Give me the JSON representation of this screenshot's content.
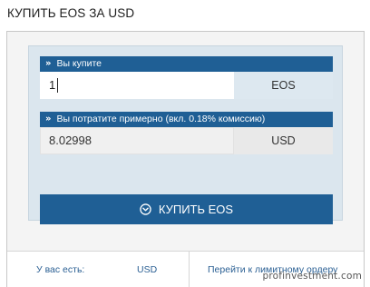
{
  "title": "КУПИТЬ EOS ЗА USD",
  "buy_field": {
    "header": "Вы купите",
    "value": "1",
    "unit": "EOS"
  },
  "spend_field": {
    "header": "Вы потратите примерно (вкл. 0.18% комиссию)",
    "value": "8.02998",
    "unit": "USD"
  },
  "buy_button": {
    "label": "КУПИТЬ EOS",
    "icon": "chevron-down-circle-icon"
  },
  "footer": {
    "balance_label": "У вас есть:",
    "balance_currency": "USD",
    "limit_link": "Перейти к лимитному ордеру"
  },
  "watermark": "profinvestment.com",
  "colors": {
    "primary": "#1f5f95",
    "form_bg": "#dbe6ee",
    "link": "#2a5f93"
  }
}
